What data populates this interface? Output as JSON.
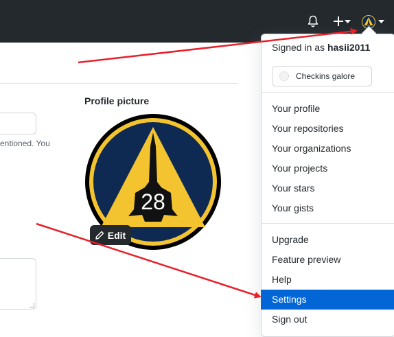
{
  "page": {
    "help_text": "entioned. You",
    "profile_picture_label": "Profile picture",
    "edit_label": "Edit",
    "avatar_number": "28"
  },
  "header": {
    "bell_icon": "bell-icon",
    "create_icon": "plus-icon",
    "avatar_icon": "avatar-icon"
  },
  "dropdown": {
    "signed_in_prefix": "Signed in as",
    "username": "hasii2011",
    "status_text": "Checkins galore",
    "items_group1": [
      "Your profile",
      "Your repositories",
      "Your organizations",
      "Your projects",
      "Your stars",
      "Your gists"
    ],
    "items_group2": [
      "Upgrade",
      "Feature preview",
      "Help",
      "Settings",
      "Sign out"
    ],
    "active_item": "Settings"
  },
  "colors": {
    "header_bg": "#24292e",
    "active_bg": "#0366d6",
    "arrow": "#e8202a",
    "badge_navy": "#0e2a52",
    "badge_yellow": "#f4c430"
  }
}
